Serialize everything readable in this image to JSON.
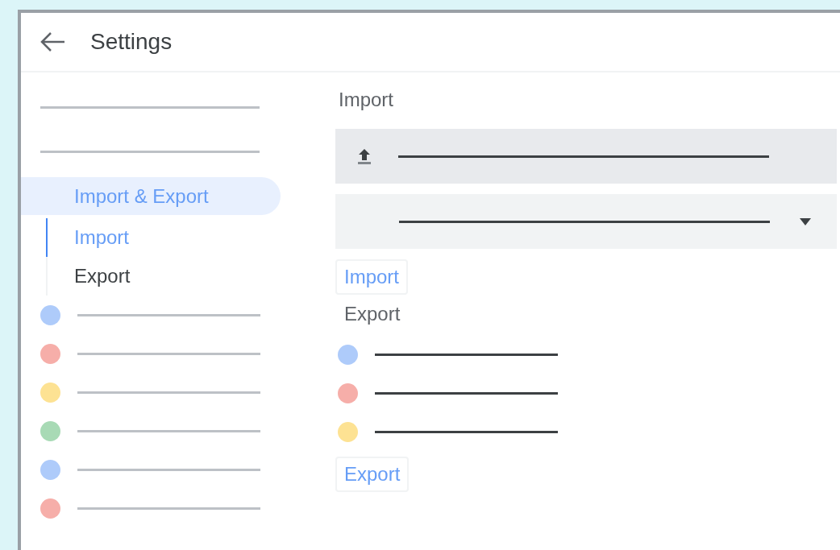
{
  "header": {
    "title": "Settings"
  },
  "sidebar": {
    "items": [
      {
        "kind": "line"
      },
      {
        "kind": "line"
      },
      {
        "kind": "group",
        "label": "Import & Export",
        "selected": true,
        "children": [
          {
            "label": "Import",
            "selected": true
          },
          {
            "label": "Export",
            "selected": false
          }
        ]
      },
      {
        "kind": "dot",
        "color": "#aecbfa"
      },
      {
        "kind": "dot",
        "color": "#f6aea9"
      },
      {
        "kind": "dot",
        "color": "#fde293"
      },
      {
        "kind": "dot",
        "color": "#a8dab5"
      },
      {
        "kind": "dot",
        "color": "#aecbfa"
      },
      {
        "kind": "dot",
        "color": "#f6aea9"
      }
    ]
  },
  "import": {
    "heading": "Import",
    "button": "Import"
  },
  "export": {
    "heading": "Export",
    "button": "Export",
    "options": [
      {
        "color": "#aecbfa"
      },
      {
        "color": "#f6aea9"
      },
      {
        "color": "#fde293"
      }
    ]
  }
}
